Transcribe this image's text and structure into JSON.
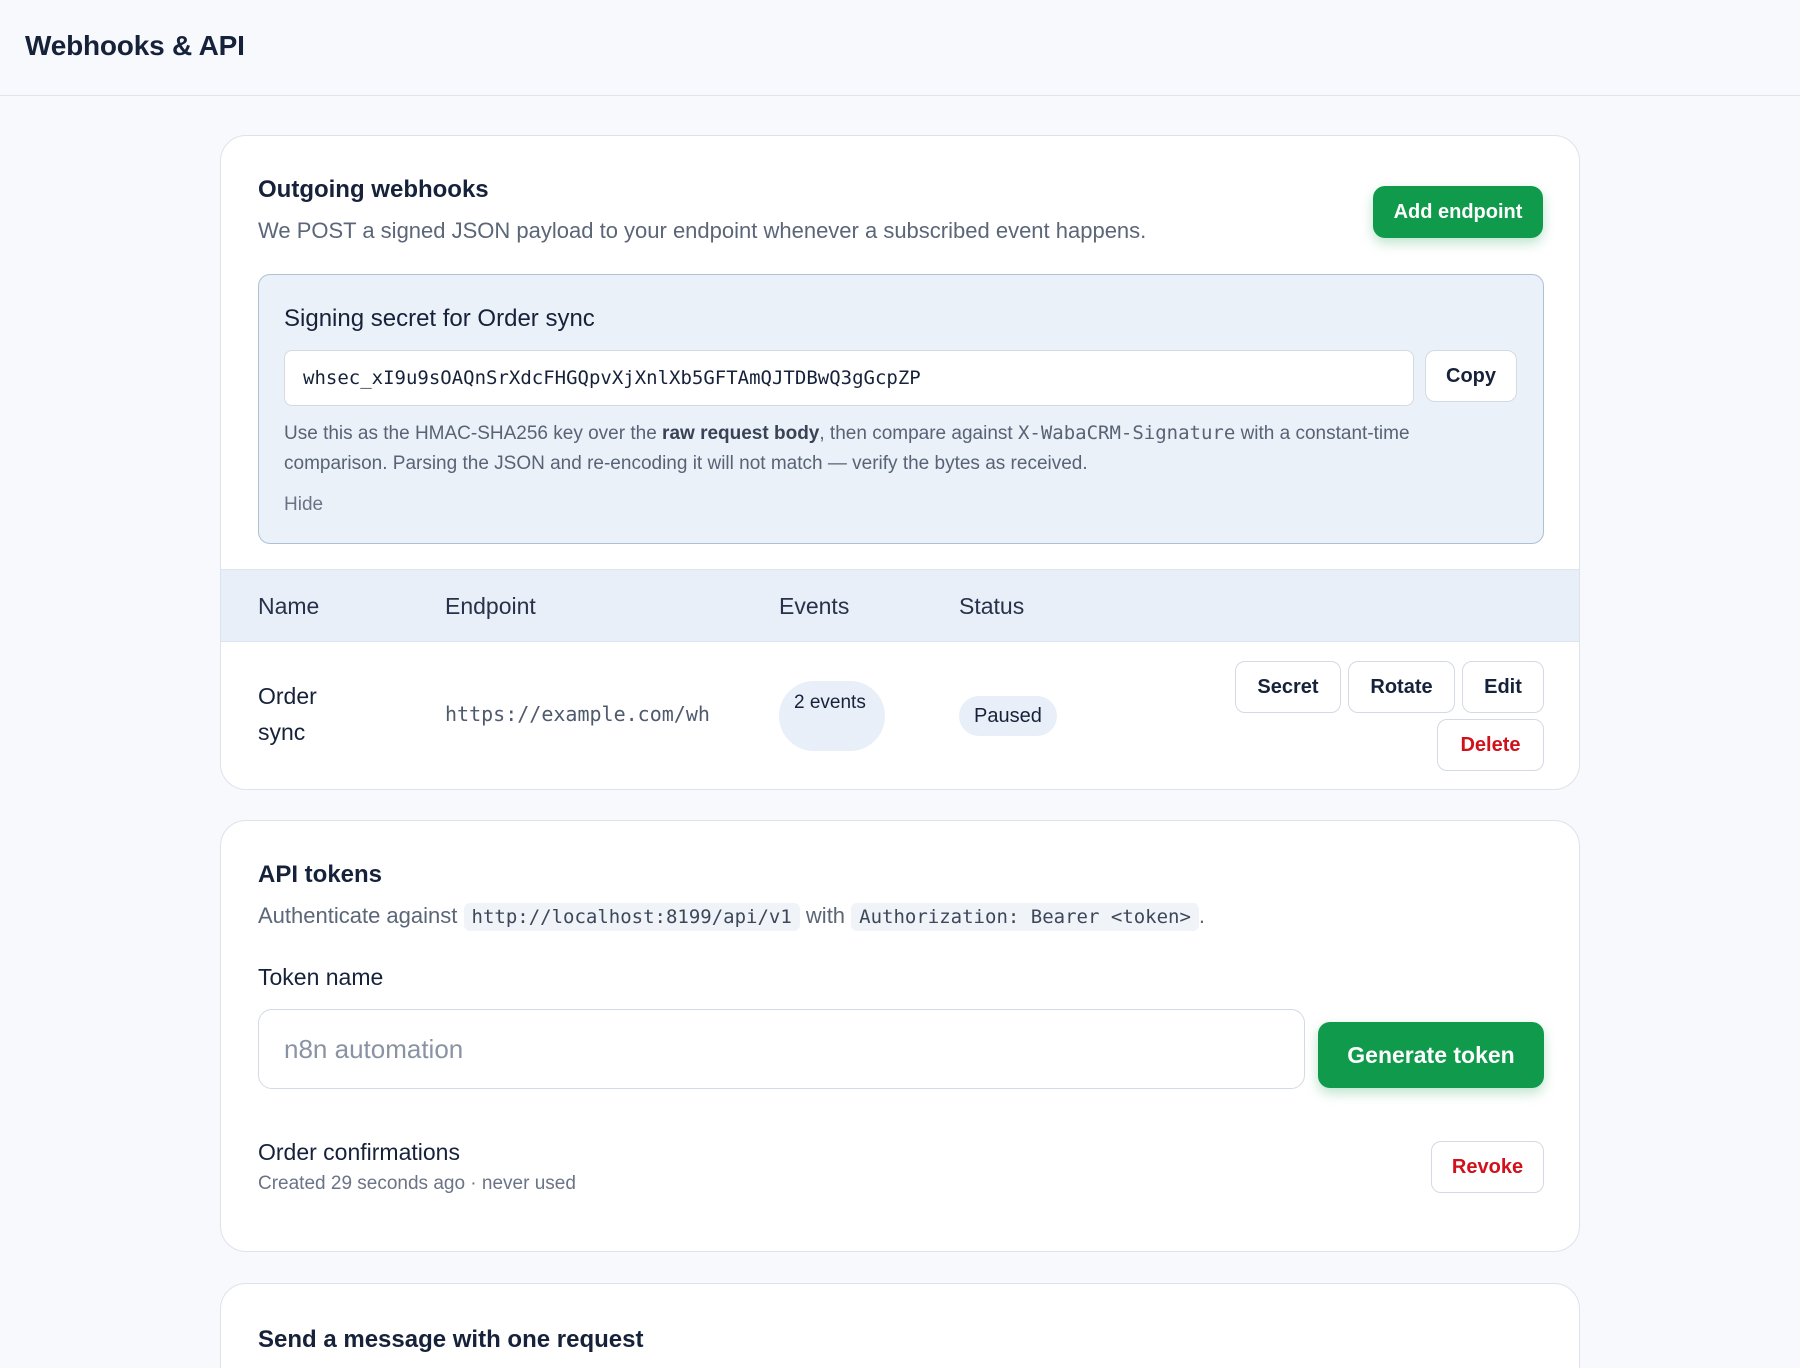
{
  "page": {
    "title": "Webhooks & API"
  },
  "webhooks": {
    "title": "Outgoing webhooks",
    "description": "We POST a signed JSON payload to your endpoint whenever a subscribed event happens.",
    "add_button": "Add endpoint",
    "secret": {
      "title": "Signing secret for Order sync",
      "value": "whsec_xI9u9sOAQnSrXdcFHGQpvXjXnlXb5GFTAmQJTDBwQ3gGcpZP",
      "copy_label": "Copy",
      "help_1": "Use this as the HMAC-SHA256 key over the ",
      "help_bold": "raw request body",
      "help_2": ", then compare against ",
      "help_code": "X-WabaCRM-Signature",
      "help_3": " with a constant-time comparison. Parsing the JSON and re-encoding it will not match — verify the bytes as received.",
      "hide_label": "Hide"
    },
    "columns": [
      "Name",
      "Endpoint",
      "Events",
      "Status"
    ],
    "rows": [
      {
        "name": "Order sync",
        "endpoint": "https://example.com/wh",
        "events": "2 events",
        "status": "Paused",
        "actions": {
          "secret": "Secret",
          "rotate": "Rotate",
          "edit": "Edit",
          "delete": "Delete"
        }
      }
    ]
  },
  "api_tokens": {
    "title": "API tokens",
    "desc_prefix": "Authenticate against",
    "base_url": "http://localhost:8199/api/v1",
    "desc_with": "with",
    "auth_header": "Authorization: Bearer <token>",
    "desc_suffix": ".",
    "field_label": "Token name",
    "field_placeholder": "n8n automation",
    "generate_button": "Generate token",
    "tokens": [
      {
        "name": "Order confirmations",
        "meta": "Created 29 seconds ago · never used",
        "revoke_label": "Revoke"
      }
    ]
  },
  "send_message": {
    "title": "Send a message with one request"
  },
  "colors": {
    "accent": "#0f9b4b",
    "danger": "#d1111b",
    "secret_bg": "#ebf1f9",
    "table_header_bg": "#e9eff8"
  }
}
